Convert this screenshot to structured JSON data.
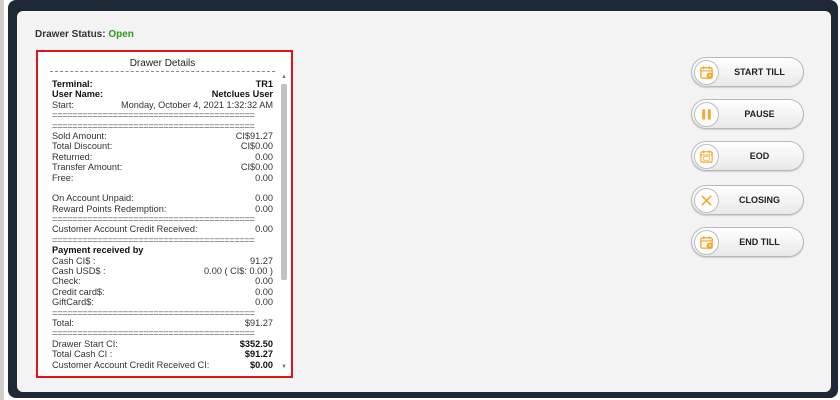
{
  "status": {
    "label": "Drawer Status:",
    "value": "Open"
  },
  "drawer_details": {
    "title": "Drawer Details",
    "terminal_label": "Terminal:",
    "terminal_value": "TR1",
    "user_label": "User Name:",
    "user_value": "Netclues User",
    "start_label": "Start:",
    "start_value": "Monday, October 4, 2021 1:32:32 AM",
    "sep_line": "========================================",
    "sold_label": "Sold Amount:",
    "sold_value": "CI$91.27",
    "discount_label": "Total Discount:",
    "discount_value": "CI$0.00",
    "returned_label": "Returned:",
    "returned_value": "0.00",
    "transfer_label": "Transfer Amount:",
    "transfer_value": "CI$0.00",
    "free_label": "Free:",
    "free_value": "0.00",
    "unpaid_label": "On Account Unpaid:",
    "unpaid_value": "0.00",
    "reward_label": "Reward Points Redemption:",
    "reward_value": "0.00",
    "cacr_label": "Customer Account Credit Received:",
    "cacr_value": "0.00",
    "payment_heading": "Payment received by",
    "cash_ci_label": "Cash CI$ :",
    "cash_ci_value": "91.27",
    "cash_usd_label": "Cash USD$ :",
    "cash_usd_value": "0.00 ( CI$: 0.00 )",
    "check_label": "Check:",
    "check_value": "0.00",
    "credit_label": "Credit card$:",
    "credit_value": "0.00",
    "gift_label": "GiftCard$:",
    "gift_value": "0.00",
    "total_label": "Total:",
    "total_value": "$91.27",
    "drawer_start_label": "Drawer Start CI:",
    "drawer_start_value": "$352.50",
    "total_cash_label": "Total Cash CI :",
    "total_cash_value": "$91.27",
    "cacr_ci_label": "Customer Account Credit Received CI:",
    "cacr_ci_value": "$0.00"
  },
  "actions": {
    "start_till": "START TILL",
    "pause": "PAUSE",
    "eod": "EOD",
    "closing": "CLOSING",
    "end_till": "END TILL"
  },
  "colors": {
    "accent": "#f5a623",
    "status_open": "#2e9a1f",
    "highlight": "#e0141c",
    "frame": "#1d2a36"
  }
}
